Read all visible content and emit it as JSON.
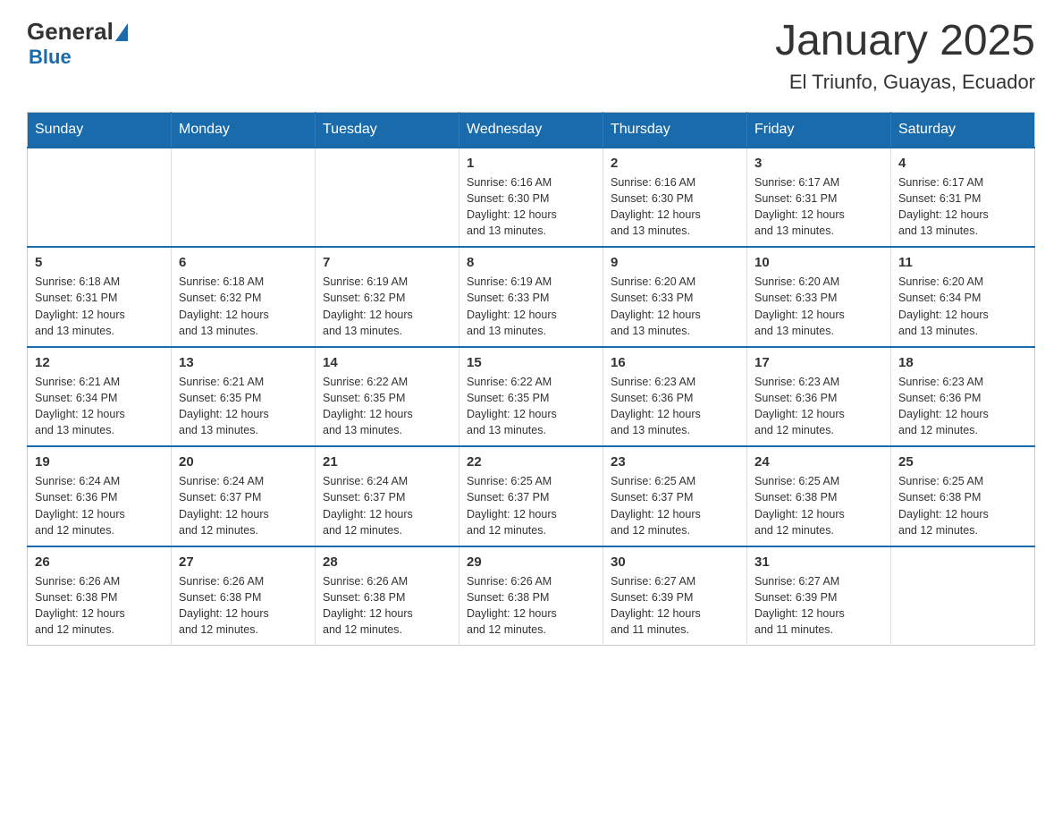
{
  "header": {
    "logo_general": "General",
    "logo_blue": "Blue",
    "month_title": "January 2025",
    "location": "El Triunfo, Guayas, Ecuador"
  },
  "weekdays": [
    "Sunday",
    "Monday",
    "Tuesday",
    "Wednesday",
    "Thursday",
    "Friday",
    "Saturday"
  ],
  "weeks": [
    [
      {
        "day": "",
        "info": ""
      },
      {
        "day": "",
        "info": ""
      },
      {
        "day": "",
        "info": ""
      },
      {
        "day": "1",
        "info": "Sunrise: 6:16 AM\nSunset: 6:30 PM\nDaylight: 12 hours\nand 13 minutes."
      },
      {
        "day": "2",
        "info": "Sunrise: 6:16 AM\nSunset: 6:30 PM\nDaylight: 12 hours\nand 13 minutes."
      },
      {
        "day": "3",
        "info": "Sunrise: 6:17 AM\nSunset: 6:31 PM\nDaylight: 12 hours\nand 13 minutes."
      },
      {
        "day": "4",
        "info": "Sunrise: 6:17 AM\nSunset: 6:31 PM\nDaylight: 12 hours\nand 13 minutes."
      }
    ],
    [
      {
        "day": "5",
        "info": "Sunrise: 6:18 AM\nSunset: 6:31 PM\nDaylight: 12 hours\nand 13 minutes."
      },
      {
        "day": "6",
        "info": "Sunrise: 6:18 AM\nSunset: 6:32 PM\nDaylight: 12 hours\nand 13 minutes."
      },
      {
        "day": "7",
        "info": "Sunrise: 6:19 AM\nSunset: 6:32 PM\nDaylight: 12 hours\nand 13 minutes."
      },
      {
        "day": "8",
        "info": "Sunrise: 6:19 AM\nSunset: 6:33 PM\nDaylight: 12 hours\nand 13 minutes."
      },
      {
        "day": "9",
        "info": "Sunrise: 6:20 AM\nSunset: 6:33 PM\nDaylight: 12 hours\nand 13 minutes."
      },
      {
        "day": "10",
        "info": "Sunrise: 6:20 AM\nSunset: 6:33 PM\nDaylight: 12 hours\nand 13 minutes."
      },
      {
        "day": "11",
        "info": "Sunrise: 6:20 AM\nSunset: 6:34 PM\nDaylight: 12 hours\nand 13 minutes."
      }
    ],
    [
      {
        "day": "12",
        "info": "Sunrise: 6:21 AM\nSunset: 6:34 PM\nDaylight: 12 hours\nand 13 minutes."
      },
      {
        "day": "13",
        "info": "Sunrise: 6:21 AM\nSunset: 6:35 PM\nDaylight: 12 hours\nand 13 minutes."
      },
      {
        "day": "14",
        "info": "Sunrise: 6:22 AM\nSunset: 6:35 PM\nDaylight: 12 hours\nand 13 minutes."
      },
      {
        "day": "15",
        "info": "Sunrise: 6:22 AM\nSunset: 6:35 PM\nDaylight: 12 hours\nand 13 minutes."
      },
      {
        "day": "16",
        "info": "Sunrise: 6:23 AM\nSunset: 6:36 PM\nDaylight: 12 hours\nand 13 minutes."
      },
      {
        "day": "17",
        "info": "Sunrise: 6:23 AM\nSunset: 6:36 PM\nDaylight: 12 hours\nand 12 minutes."
      },
      {
        "day": "18",
        "info": "Sunrise: 6:23 AM\nSunset: 6:36 PM\nDaylight: 12 hours\nand 12 minutes."
      }
    ],
    [
      {
        "day": "19",
        "info": "Sunrise: 6:24 AM\nSunset: 6:36 PM\nDaylight: 12 hours\nand 12 minutes."
      },
      {
        "day": "20",
        "info": "Sunrise: 6:24 AM\nSunset: 6:37 PM\nDaylight: 12 hours\nand 12 minutes."
      },
      {
        "day": "21",
        "info": "Sunrise: 6:24 AM\nSunset: 6:37 PM\nDaylight: 12 hours\nand 12 minutes."
      },
      {
        "day": "22",
        "info": "Sunrise: 6:25 AM\nSunset: 6:37 PM\nDaylight: 12 hours\nand 12 minutes."
      },
      {
        "day": "23",
        "info": "Sunrise: 6:25 AM\nSunset: 6:37 PM\nDaylight: 12 hours\nand 12 minutes."
      },
      {
        "day": "24",
        "info": "Sunrise: 6:25 AM\nSunset: 6:38 PM\nDaylight: 12 hours\nand 12 minutes."
      },
      {
        "day": "25",
        "info": "Sunrise: 6:25 AM\nSunset: 6:38 PM\nDaylight: 12 hours\nand 12 minutes."
      }
    ],
    [
      {
        "day": "26",
        "info": "Sunrise: 6:26 AM\nSunset: 6:38 PM\nDaylight: 12 hours\nand 12 minutes."
      },
      {
        "day": "27",
        "info": "Sunrise: 6:26 AM\nSunset: 6:38 PM\nDaylight: 12 hours\nand 12 minutes."
      },
      {
        "day": "28",
        "info": "Sunrise: 6:26 AM\nSunset: 6:38 PM\nDaylight: 12 hours\nand 12 minutes."
      },
      {
        "day": "29",
        "info": "Sunrise: 6:26 AM\nSunset: 6:38 PM\nDaylight: 12 hours\nand 12 minutes."
      },
      {
        "day": "30",
        "info": "Sunrise: 6:27 AM\nSunset: 6:39 PM\nDaylight: 12 hours\nand 11 minutes."
      },
      {
        "day": "31",
        "info": "Sunrise: 6:27 AM\nSunset: 6:39 PM\nDaylight: 12 hours\nand 11 minutes."
      },
      {
        "day": "",
        "info": ""
      }
    ]
  ]
}
